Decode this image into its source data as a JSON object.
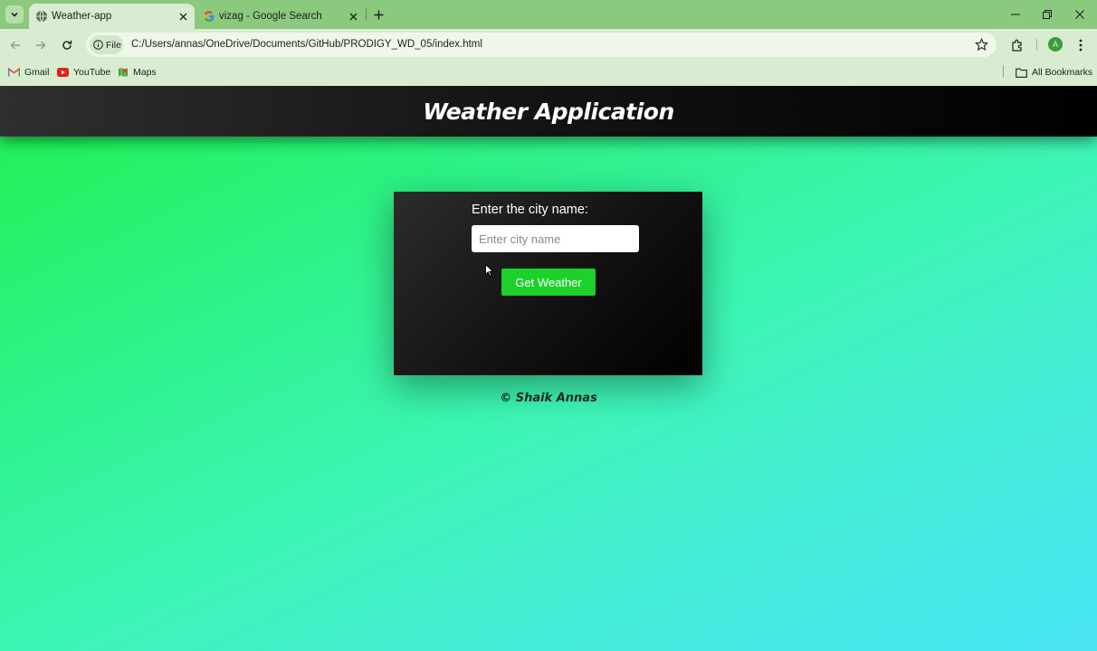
{
  "browser": {
    "tabs": [
      {
        "title": "Weather-app",
        "active": true,
        "favicon": "globe-icon"
      },
      {
        "title": "vizag - Google Search",
        "active": false,
        "favicon": "google-icon"
      }
    ],
    "site_chip": "File",
    "url": "C:/Users/annas/OneDrive/Documents/GitHub/PRODIGY_WD_05/index.html",
    "profile_initial": "A",
    "bookmarks": [
      {
        "label": "Gmail",
        "icon": "gmail-icon"
      },
      {
        "label": "YouTube",
        "icon": "youtube-icon"
      },
      {
        "label": "Maps",
        "icon": "maps-icon"
      }
    ],
    "all_bookmarks": "All Bookmarks"
  },
  "app": {
    "title": "Weather Application",
    "city_label": "Enter the city name:",
    "city_placeholder": "Enter city name",
    "city_value": "",
    "button_label": "Get Weather",
    "footer": "© Shaik Annas"
  },
  "colors": {
    "header_bg": "#000000",
    "button_bg": "#1ed12a",
    "page_gradient_start": "#1ff14e",
    "page_gradient_end": "#4ae6f6"
  }
}
